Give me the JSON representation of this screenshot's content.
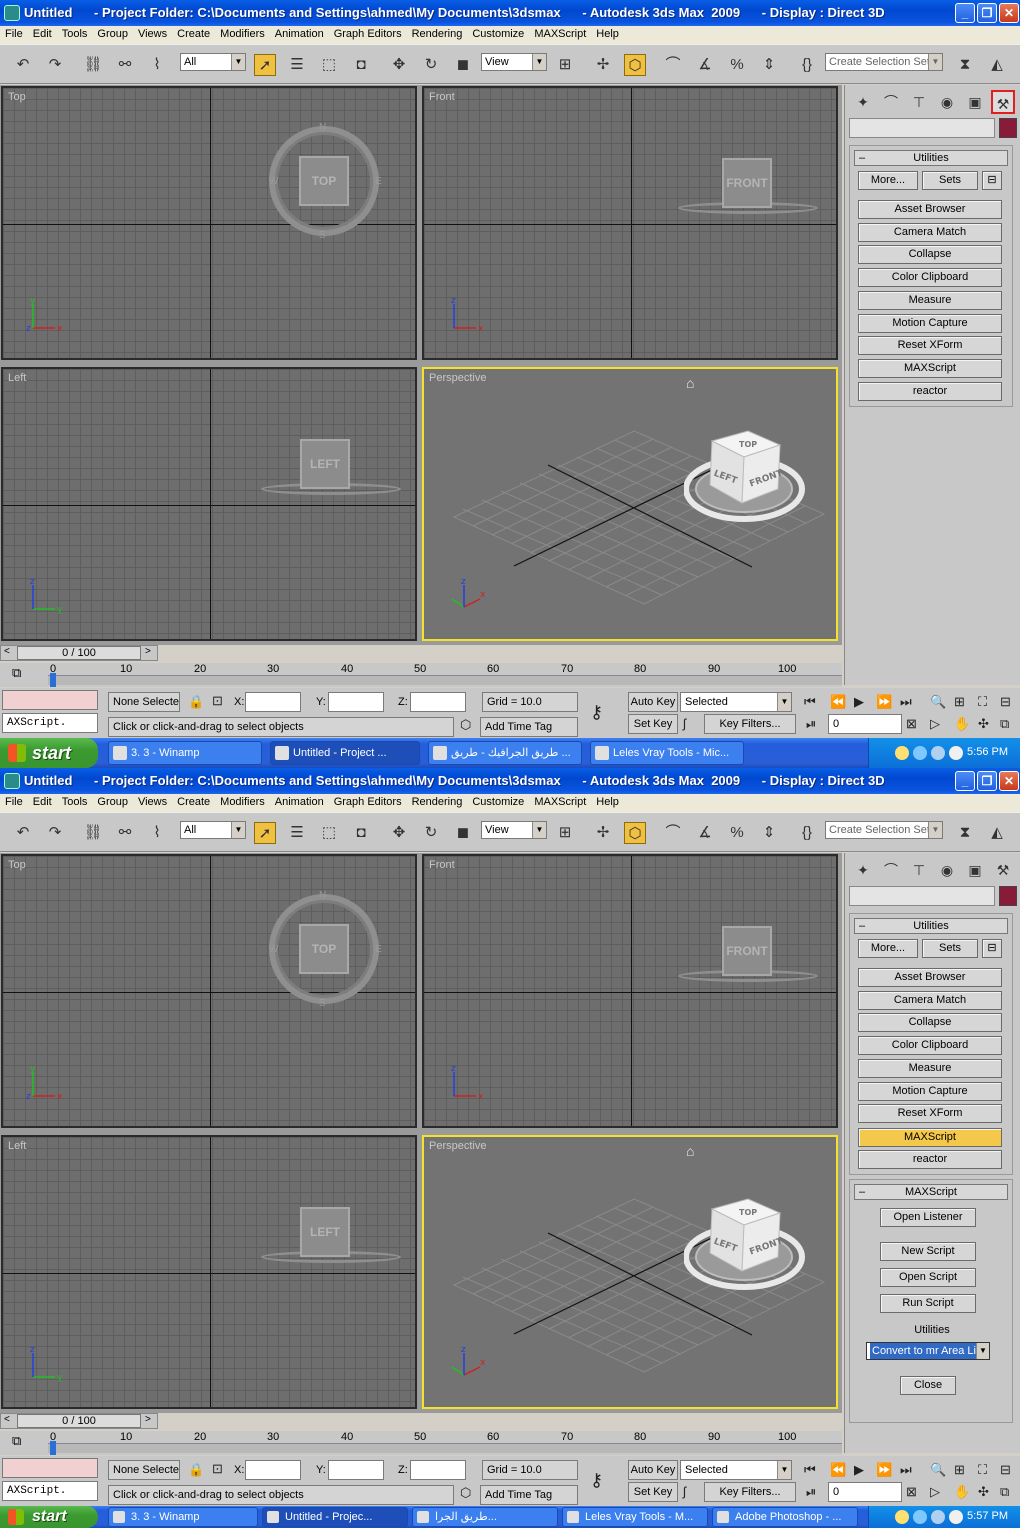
{
  "window": {
    "title": "Untitled      - Project Folder: C:\\Documents and Settings\\ahmed\\My Documents\\3dsmax      - Autodesk 3ds Max  2009      - Display : Direct 3D"
  },
  "menu": [
    "File",
    "Edit",
    "Tools",
    "Group",
    "Views",
    "Create",
    "Modifiers",
    "Animation",
    "Graph Editors",
    "Rendering",
    "Customize",
    "MAXScript",
    "Help"
  ],
  "toolbar": {
    "filter": "All",
    "view": "View",
    "selection_set_placeholder": "Create Selection Set"
  },
  "viewports": {
    "top": "Top",
    "front": "Front",
    "left": "Left",
    "perspective": "Perspective",
    "cube_top": "TOP",
    "cube_front": "FRONT",
    "cube_left": "LEFT",
    "compass_n": "N",
    "compass_s": "S",
    "compass_w": "W",
    "compass_e": "E"
  },
  "panel": {
    "utilities_title": "Utilities",
    "more": "More...",
    "sets": "Sets",
    "buttons": [
      "Asset Browser",
      "Camera Match",
      "Collapse",
      "Color Clipboard",
      "Measure",
      "Motion Capture",
      "Reset XForm",
      "MAXScript",
      "reactor"
    ],
    "maxscript_title": "MAXScript",
    "open_listener": "Open Listener",
    "new_script": "New Script",
    "open_script": "Open Script",
    "run_script": "Run Script",
    "utilities_label": "Utilities",
    "utilities_select": "Convert to mr Area Li",
    "close": "Close"
  },
  "timeline": {
    "slider": "0 / 100",
    "ticks": [
      "0",
      "10",
      "20",
      "30",
      "40",
      "50",
      "60",
      "70",
      "80",
      "90",
      "100"
    ]
  },
  "status": {
    "script_field": "AXScript.",
    "none_selected": "None Selecte",
    "x_label": "X:",
    "y_label": "Y:",
    "z_label": "Z:",
    "grid": "Grid = 10.0",
    "prompt": "Click or click-and-drag to select objects",
    "add_time_tag": "Add Time Tag",
    "auto_key": "Auto Key",
    "set_key": "Set Key",
    "selected": "Selected",
    "key_filters": "Key Filters...",
    "frame": "0"
  },
  "taskbar1": {
    "start": "start",
    "tasks": [
      "3. 3 - Winamp",
      "Untitled      - Project ...",
      "طريق الجرافيك - طريق ...",
      "Leles Vray Tools - Mic..."
    ],
    "clock": "5:56 PM"
  },
  "taskbar2": {
    "start": "start",
    "tasks": [
      "3. 3 - Winamp",
      "Untitled      - Projec...",
      "طريق الجرا...",
      "Leles Vray Tools - M...",
      "Adobe Photoshop - ..."
    ],
    "clock": "5:57 PM"
  }
}
